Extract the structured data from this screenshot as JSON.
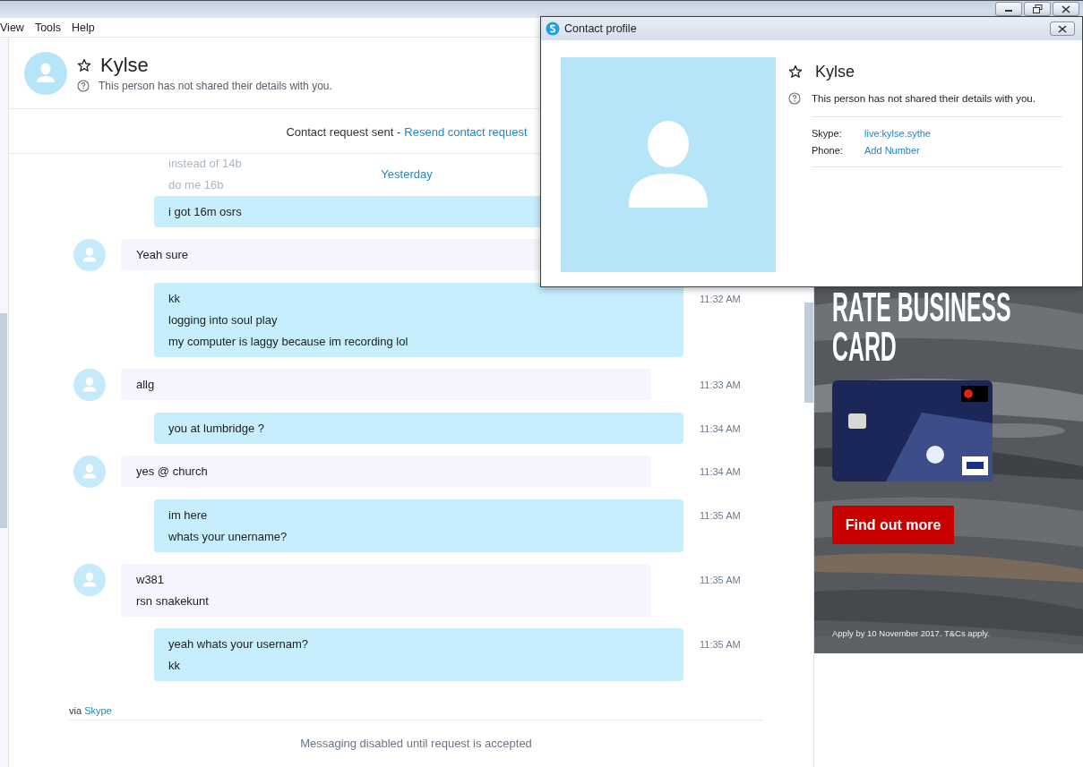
{
  "menu": [
    {
      "label": "View"
    },
    {
      "label": "Tools"
    },
    {
      "label": "Help"
    }
  ],
  "contact": {
    "name": "Kylse",
    "status": "This person has not shared their details with you."
  },
  "request_bar": {
    "text": "Contact request sent -",
    "link": "Resend contact request"
  },
  "date_divider": "Yesterday",
  "messages": [
    {
      "kind": "outgoing",
      "scrolled_lines": [
        "instead of 14b",
        "do me 16b"
      ],
      "lines": [
        "i got 16m osrs"
      ]
    },
    {
      "kind": "incoming",
      "lines": [
        "Yeah sure"
      ]
    },
    {
      "kind": "outgoing",
      "lines": [
        "kk",
        "logging into soul play",
        "my computer is laggy because im recording lol"
      ],
      "time": "11:32 AM"
    },
    {
      "kind": "incoming",
      "lines": [
        "allg"
      ],
      "time": "11:33 AM"
    },
    {
      "kind": "outgoing",
      "lines": [
        "you at lumbridge ?"
      ],
      "time": "11:34 AM"
    },
    {
      "kind": "incoming",
      "lines": [
        "yes @ church"
      ],
      "time": "11:34 AM"
    },
    {
      "kind": "outgoing",
      "lines": [
        "im here",
        "whats your unername?"
      ],
      "time": "11:35 AM"
    },
    {
      "kind": "incoming",
      "lines": [
        "w381",
        "rsn snakekunt"
      ],
      "time": "11:35 AM"
    },
    {
      "kind": "outgoing",
      "lines": [
        "yeah whats your usernam?",
        "kk"
      ],
      "time": "11:35 AM"
    }
  ],
  "footer": {
    "via": "via",
    "source": "Skype",
    "notice": "Messaging disabled until request is accepted"
  },
  "ad": {
    "headline_lines": [
      "RATE BUSINESS",
      "CARD"
    ],
    "button": "Find out more",
    "fine_print": "Apply by 10 November 2017. T&Cs apply."
  },
  "profile_dialog": {
    "title": "Contact profile",
    "name": "Kylse",
    "status": "This person has not shared their details with you.",
    "fields": [
      {
        "label": "Skype:",
        "value": "live:kylse.sythe"
      },
      {
        "label": "Phone:",
        "value": "Add Number"
      }
    ]
  }
}
